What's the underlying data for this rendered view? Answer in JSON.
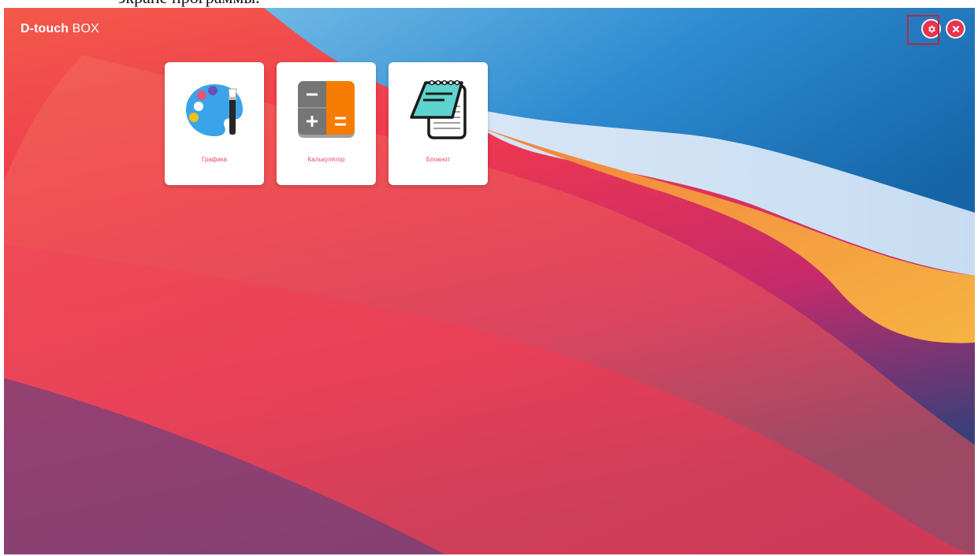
{
  "document": {
    "caption_fragment": "экране программы."
  },
  "app": {
    "brand_bold": "D-touch",
    "brand_light": " BOX"
  },
  "top_actions": {
    "settings_icon": "gear-icon",
    "close_icon": "close-icon",
    "button_color": "#e7354e",
    "highlight_color": "#b42a42"
  },
  "tiles": [
    {
      "label": "Графика",
      "icon": "palette-icon"
    },
    {
      "label": "Калькулятор",
      "icon": "calculator-icon"
    },
    {
      "label": "Блокнот",
      "icon": "notepad-icon"
    }
  ],
  "colors": {
    "label": "#e74c5e",
    "calc_orange": "#f57c00",
    "calc_grey": "#757575",
    "notepad_teal": "#5dd4cf"
  }
}
